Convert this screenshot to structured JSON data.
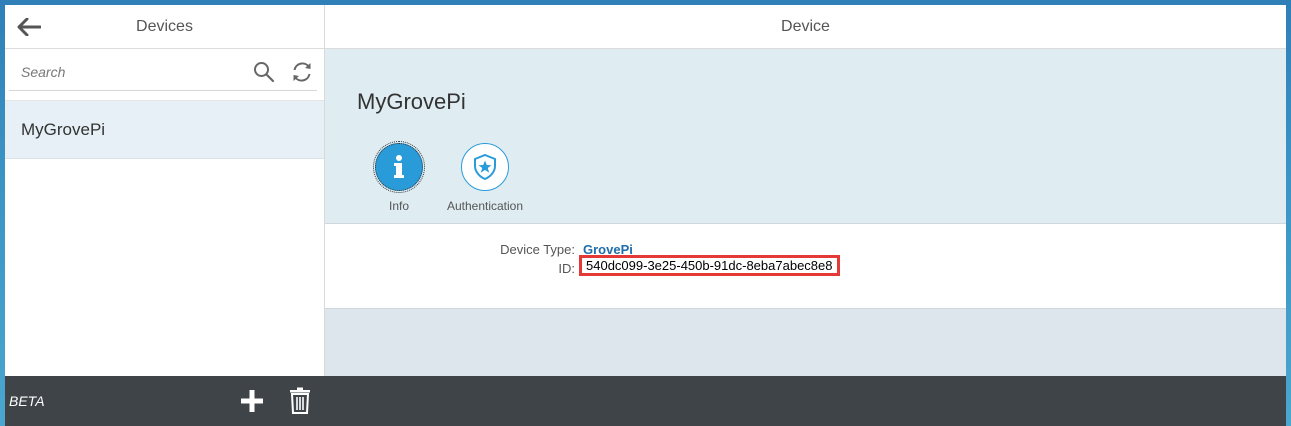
{
  "master": {
    "title": "Devices",
    "search_placeholder": "Search",
    "items": [
      {
        "label": "MyGrovePi"
      }
    ],
    "footer": {
      "beta_label": "BETA"
    }
  },
  "detail": {
    "title": "Device",
    "object_title": "MyGrovePi",
    "tabs": [
      {
        "label": "Info",
        "icon": "info-icon",
        "selected": true
      },
      {
        "label": "Authentication",
        "icon": "shield-star-icon",
        "selected": false
      }
    ],
    "fields": {
      "device_type_label": "Device Type:",
      "device_type_value": "GrovePi",
      "id_label": "ID:",
      "id_value": "540dc099-3e25-450b-91dc-8eba7abec8e8"
    }
  },
  "colors": {
    "accent": "#2a9bd9",
    "footer": "#3e4447",
    "highlight": "#e53935",
    "link": "#1f6eab"
  }
}
